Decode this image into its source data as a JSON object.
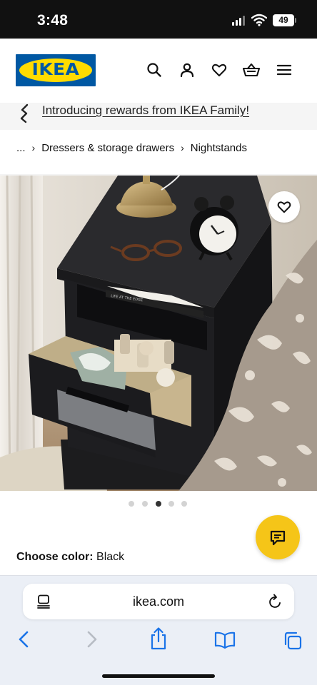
{
  "status_bar": {
    "time": "3:48",
    "battery": "49"
  },
  "header": {
    "logo_text": "IKEA",
    "icons": [
      "search-icon",
      "profile-icon",
      "heart-icon",
      "cart-icon",
      "menu-icon"
    ]
  },
  "promo": {
    "icon": "rewards-icon",
    "text": "Introducing rewards from IKEA Family!"
  },
  "breadcrumb": {
    "items": [
      "...",
      "Dressers & storage drawers",
      "Nightstands"
    ],
    "separator": "›"
  },
  "product": {
    "image_label": "Nightstand with open drawer",
    "carousel": {
      "count": 5,
      "active": 3
    }
  },
  "color": {
    "label": "Choose color:",
    "value": "Black"
  },
  "browser": {
    "url": "ikea.com",
    "icons": [
      "page-menu-icon",
      "reload-icon",
      "back-icon",
      "forward-icon",
      "share-icon",
      "bookmarks-icon",
      "tabs-icon"
    ]
  },
  "colors": {
    "ikea_blue": "#0058a3",
    "ikea_yellow": "#ffdb00",
    "chat_yellow": "#f5c518",
    "safari_blue": "#1a73e8"
  }
}
